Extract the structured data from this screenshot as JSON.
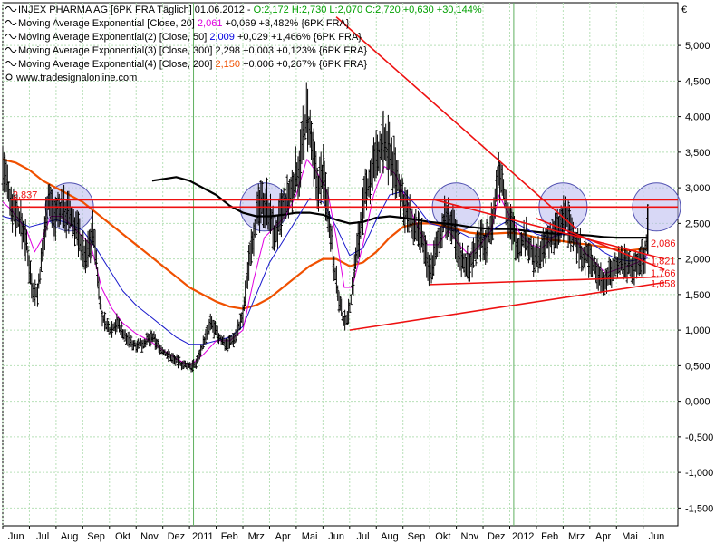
{
  "chart_data": {
    "type": "candlestick",
    "legend": [
      {
        "icon": "wave-icon",
        "parts": [
          {
            "text": "INJEX PHARMA AG [6PK FRA  Täglich] 01.06.2012 - ",
            "color": "#000000"
          },
          {
            "text": "O:2,172 H:2,730 L:2,070 C:2,720 +0,630 +30,144%",
            "color": "#00a000"
          }
        ]
      },
      {
        "icon": "wave-icon",
        "parts": [
          {
            "text": "Moving Average Exponential [Close, 20] ",
            "color": "#000000"
          },
          {
            "text": "2,061",
            "color": "#e000e0"
          },
          {
            "text": " +0,069 +3,482% {6PK FRA}",
            "color": "#000000"
          }
        ]
      },
      {
        "icon": "wave-icon",
        "parts": [
          {
            "text": "Moving Average Exponential(2) [Close, 50] ",
            "color": "#000000"
          },
          {
            "text": "2,009",
            "color": "#0000e0"
          },
          {
            "text": " +0,029 +1,466% {6PK FRA}",
            "color": "#000000"
          }
        ]
      },
      {
        "icon": "wave-icon",
        "parts": [
          {
            "text": "Moving Average Exponential(3) [Close, 300] ",
            "color": "#000000"
          },
          {
            "text": "2,298",
            "color": "#000000"
          },
          {
            "text": " +0,003 +0,123% {6PK FRA}",
            "color": "#000000"
          }
        ]
      },
      {
        "icon": "wave-icon",
        "parts": [
          {
            "text": "Moving Average Exponential(4) [Close, 200] ",
            "color": "#000000"
          },
          {
            "text": "2,150",
            "color": "#f05000"
          },
          {
            "text": " +0,006 +0,267% {6PK FRA}",
            "color": "#000000"
          }
        ]
      }
    ],
    "watermark": "www.tradesignalonline.com",
    "currency": "€",
    "y_ticks": [
      "5,000",
      "4,500",
      "4,000",
      "3,500",
      "3,000",
      "2,500",
      "2,000",
      "1,500",
      "1,000",
      "0,500",
      "0,000",
      "-0,500",
      "-1,000",
      "-1,500"
    ],
    "y_values": [
      5,
      4.5,
      4,
      3.5,
      3,
      2.5,
      2,
      1.5,
      1,
      0.5,
      0,
      -0.5,
      -1,
      -1.5
    ],
    "ylim": [
      -1.75,
      5.6
    ],
    "xlim": [
      0,
      25.3
    ],
    "x_ticks": [
      {
        "label": "Jun",
        "m": 0.5
      },
      {
        "label": "Jul",
        "m": 1.5
      },
      {
        "label": "Aug",
        "m": 2.5
      },
      {
        "label": "Sep",
        "m": 3.5
      },
      {
        "label": "Okt",
        "m": 4.5
      },
      {
        "label": "Nov",
        "m": 5.5
      },
      {
        "label": "Dez",
        "m": 6.5
      },
      {
        "label": "2011",
        "m": 7.5
      },
      {
        "label": "Feb",
        "m": 8.5
      },
      {
        "label": "Mrz",
        "m": 9.5
      },
      {
        "label": "Apr",
        "m": 10.5
      },
      {
        "label": "Mai",
        "m": 11.5
      },
      {
        "label": "Jun",
        "m": 12.5
      },
      {
        "label": "Jul",
        "m": 13.5
      },
      {
        "label": "Aug",
        "m": 14.5
      },
      {
        "label": "Sep",
        "m": 15.5
      },
      {
        "label": "Okt",
        "m": 16.5
      },
      {
        "label": "Nov",
        "m": 17.5
      },
      {
        "label": "Dez",
        "m": 18.5
      },
      {
        "label": "2012",
        "m": 19.5
      },
      {
        "label": "Feb",
        "m": 20.5
      },
      {
        "label": "Mrz",
        "m": 21.5
      },
      {
        "label": "Apr",
        "m": 22.5
      },
      {
        "label": "Mai",
        "m": 23.5
      },
      {
        "label": "Jun",
        "m": 24.5
      }
    ],
    "year_lines": [
      7.15,
      19.15
    ],
    "price_path": [
      [
        0,
        3.3
      ],
      [
        0.3,
        2.8
      ],
      [
        0.6,
        2.6
      ],
      [
        0.9,
        2.2
      ],
      [
        1.1,
        1.6
      ],
      [
        1.3,
        1.5
      ],
      [
        1.5,
        2.1
      ],
      [
        1.7,
        2.9
      ],
      [
        1.9,
        2.6
      ],
      [
        2.2,
        2.7
      ],
      [
        2.5,
        2.6
      ],
      [
        2.8,
        2.4
      ],
      [
        3.1,
        2.0
      ],
      [
        3.4,
        2.4
      ],
      [
        3.7,
        1.2
      ],
      [
        4.0,
        1.0
      ],
      [
        4.3,
        1.1
      ],
      [
        4.6,
        0.9
      ],
      [
        4.9,
        0.8
      ],
      [
        5.2,
        0.8
      ],
      [
        5.6,
        0.9
      ],
      [
        6.0,
        0.7
      ],
      [
        6.4,
        0.6
      ],
      [
        6.8,
        0.5
      ],
      [
        7.2,
        0.5
      ],
      [
        7.5,
        0.8
      ],
      [
        7.8,
        1.1
      ],
      [
        8.1,
        0.9
      ],
      [
        8.4,
        0.8
      ],
      [
        8.7,
        0.9
      ],
      [
        9.0,
        1.2
      ],
      [
        9.3,
        2.2
      ],
      [
        9.6,
        2.7
      ],
      [
        9.9,
        2.8
      ],
      [
        10.2,
        2.3
      ],
      [
        10.5,
        2.7
      ],
      [
        10.8,
        2.9
      ],
      [
        11.1,
        3.3
      ],
      [
        11.4,
        4.0
      ],
      [
        11.6,
        3.5
      ],
      [
        11.8,
        3.0
      ],
      [
        12.0,
        3.2
      ],
      [
        12.2,
        2.7
      ],
      [
        12.4,
        2.0
      ],
      [
        12.6,
        1.4
      ],
      [
        12.8,
        1.1
      ],
      [
        13.0,
        1.3
      ],
      [
        13.3,
        2.2
      ],
      [
        13.6,
        2.9
      ],
      [
        13.9,
        3.3
      ],
      [
        14.2,
        3.6
      ],
      [
        14.5,
        3.5
      ],
      [
        14.8,
        3.1
      ],
      [
        15.1,
        2.7
      ],
      [
        15.4,
        2.4
      ],
      [
        15.7,
        2.3
      ],
      [
        16.0,
        1.8
      ],
      [
        16.3,
        2.2
      ],
      [
        16.6,
        2.6
      ],
      [
        16.9,
        2.4
      ],
      [
        17.2,
        2.0
      ],
      [
        17.5,
        1.9
      ],
      [
        17.8,
        2.3
      ],
      [
        18.1,
        2.2
      ],
      [
        18.4,
        2.6
      ],
      [
        18.6,
        3.3
      ],
      [
        18.8,
        2.9
      ],
      [
        19.0,
        2.5
      ],
      [
        19.3,
        2.2
      ],
      [
        19.6,
        2.3
      ],
      [
        19.9,
        2.0
      ],
      [
        20.2,
        2.1
      ],
      [
        20.5,
        2.3
      ],
      [
        20.8,
        2.4
      ],
      [
        21.1,
        2.6
      ],
      [
        21.4,
        2.3
      ],
      [
        21.7,
        2.1
      ],
      [
        22.0,
        2.0
      ],
      [
        22.3,
        1.8
      ],
      [
        22.6,
        1.7
      ],
      [
        22.9,
        1.9
      ],
      [
        23.2,
        2.0
      ],
      [
        23.5,
        1.9
      ],
      [
        23.8,
        1.9
      ],
      [
        24.0,
        2.1
      ],
      [
        24.1,
        2.0
      ],
      [
        24.17,
        2.72
      ]
    ],
    "ema20": [
      [
        0,
        2.8
      ],
      [
        0.3,
        2.7
      ],
      [
        0.6,
        2.55
      ],
      [
        0.9,
        2.4
      ],
      [
        1.2,
        2.1
      ],
      [
        1.5,
        2.3
      ],
      [
        1.8,
        2.6
      ],
      [
        2.2,
        2.6
      ],
      [
        2.5,
        2.5
      ],
      [
        2.9,
        2.35
      ],
      [
        3.3,
        2.2
      ],
      [
        3.7,
        1.6
      ],
      [
        4.1,
        1.3
      ],
      [
        4.5,
        1.1
      ],
      [
        5.0,
        0.95
      ],
      [
        5.5,
        0.85
      ],
      [
        6.0,
        0.72
      ],
      [
        6.5,
        0.6
      ],
      [
        7.0,
        0.5
      ],
      [
        7.5,
        0.65
      ],
      [
        8.0,
        0.85
      ],
      [
        8.5,
        0.85
      ],
      [
        9.0,
        1.0
      ],
      [
        9.4,
        1.7
      ],
      [
        9.8,
        2.3
      ],
      [
        10.2,
        2.45
      ],
      [
        10.6,
        2.6
      ],
      [
        11.0,
        2.9
      ],
      [
        11.4,
        3.4
      ],
      [
        11.8,
        3.2
      ],
      [
        12.2,
        2.9
      ],
      [
        12.5,
        2.3
      ],
      [
        12.8,
        1.6
      ],
      [
        13.1,
        1.6
      ],
      [
        13.5,
        2.2
      ],
      [
        13.9,
        2.9
      ],
      [
        14.3,
        3.3
      ],
      [
        14.7,
        3.2
      ],
      [
        15.1,
        2.85
      ],
      [
        15.5,
        2.5
      ],
      [
        15.9,
        2.2
      ],
      [
        16.3,
        2.2
      ],
      [
        16.7,
        2.4
      ],
      [
        17.1,
        2.2
      ],
      [
        17.5,
        2.05
      ],
      [
        17.9,
        2.2
      ],
      [
        18.3,
        2.4
      ],
      [
        18.6,
        2.9
      ],
      [
        19.0,
        2.6
      ],
      [
        19.4,
        2.35
      ],
      [
        19.8,
        2.2
      ],
      [
        20.2,
        2.15
      ],
      [
        20.6,
        2.3
      ],
      [
        21.0,
        2.45
      ],
      [
        21.4,
        2.3
      ],
      [
        21.8,
        2.1
      ],
      [
        22.2,
        1.95
      ],
      [
        22.6,
        1.8
      ],
      [
        23.0,
        1.85
      ],
      [
        23.4,
        1.9
      ],
      [
        23.8,
        1.95
      ],
      [
        24.17,
        2.06
      ]
    ],
    "ema50": [
      [
        0,
        2.6
      ],
      [
        0.5,
        2.55
      ],
      [
        1.0,
        2.45
      ],
      [
        1.5,
        2.5
      ],
      [
        2.0,
        2.55
      ],
      [
        2.5,
        2.5
      ],
      [
        3.0,
        2.4
      ],
      [
        3.5,
        2.15
      ],
      [
        4.0,
        1.85
      ],
      [
        4.5,
        1.55
      ],
      [
        5.0,
        1.35
      ],
      [
        5.5,
        1.2
      ],
      [
        6.0,
        1.05
      ],
      [
        6.5,
        0.9
      ],
      [
        7.0,
        0.8
      ],
      [
        7.5,
        0.8
      ],
      [
        8.0,
        0.85
      ],
      [
        8.5,
        0.9
      ],
      [
        9.0,
        1.05
      ],
      [
        9.5,
        1.5
      ],
      [
        10.0,
        1.95
      ],
      [
        10.5,
        2.25
      ],
      [
        11.0,
        2.55
      ],
      [
        11.5,
        2.85
      ],
      [
        12.0,
        2.8
      ],
      [
        12.5,
        2.45
      ],
      [
        13.0,
        2.05
      ],
      [
        13.5,
        2.15
      ],
      [
        14.0,
        2.55
      ],
      [
        14.5,
        2.9
      ],
      [
        15.0,
        2.95
      ],
      [
        15.5,
        2.75
      ],
      [
        16.0,
        2.5
      ],
      [
        16.5,
        2.45
      ],
      [
        17.0,
        2.4
      ],
      [
        17.5,
        2.3
      ],
      [
        18.0,
        2.3
      ],
      [
        18.5,
        2.45
      ],
      [
        19.0,
        2.55
      ],
      [
        19.5,
        2.45
      ],
      [
        20.0,
        2.35
      ],
      [
        20.5,
        2.3
      ],
      [
        21.0,
        2.35
      ],
      [
        21.5,
        2.35
      ],
      [
        22.0,
        2.25
      ],
      [
        22.5,
        2.1
      ],
      [
        23.0,
        2.0
      ],
      [
        23.5,
        1.97
      ],
      [
        24.17,
        2.01
      ]
    ],
    "ema300": [
      [
        5.6,
        3.1
      ],
      [
        6.5,
        3.15
      ],
      [
        7.0,
        3.1
      ],
      [
        7.5,
        3.0
      ],
      [
        8.0,
        2.9
      ],
      [
        8.5,
        2.75
      ],
      [
        9.0,
        2.65
      ],
      [
        9.5,
        2.6
      ],
      [
        10.0,
        2.6
      ],
      [
        10.5,
        2.62
      ],
      [
        11.0,
        2.65
      ],
      [
        11.5,
        2.65
      ],
      [
        12.0,
        2.62
      ],
      [
        12.5,
        2.55
      ],
      [
        13.0,
        2.5
      ],
      [
        13.5,
        2.52
      ],
      [
        14.0,
        2.58
      ],
      [
        14.5,
        2.6
      ],
      [
        15.0,
        2.58
      ],
      [
        15.5,
        2.55
      ],
      [
        16.0,
        2.52
      ],
      [
        16.5,
        2.5
      ],
      [
        17.0,
        2.48
      ],
      [
        17.5,
        2.45
      ],
      [
        18.0,
        2.43
      ],
      [
        18.5,
        2.42
      ],
      [
        19.0,
        2.42
      ],
      [
        19.5,
        2.4
      ],
      [
        20.0,
        2.38
      ],
      [
        20.5,
        2.36
      ],
      [
        21.0,
        2.35
      ],
      [
        21.5,
        2.34
      ],
      [
        22.0,
        2.33
      ],
      [
        22.5,
        2.31
      ],
      [
        23.0,
        2.3
      ],
      [
        23.5,
        2.3
      ],
      [
        24.17,
        2.3
      ]
    ],
    "ema200": [
      [
        0,
        3.4
      ],
      [
        0.5,
        3.35
      ],
      [
        1.0,
        3.25
      ],
      [
        1.5,
        3.1
      ],
      [
        2.0,
        3.0
      ],
      [
        2.5,
        2.9
      ],
      [
        3.0,
        2.8
      ],
      [
        3.5,
        2.65
      ],
      [
        4.0,
        2.5
      ],
      [
        4.5,
        2.35
      ],
      [
        5.0,
        2.2
      ],
      [
        5.5,
        2.05
      ],
      [
        6.0,
        1.9
      ],
      [
        6.5,
        1.75
      ],
      [
        7.0,
        1.6
      ],
      [
        7.5,
        1.5
      ],
      [
        8.0,
        1.4
      ],
      [
        8.5,
        1.33
      ],
      [
        9.0,
        1.3
      ],
      [
        9.5,
        1.35
      ],
      [
        10.0,
        1.45
      ],
      [
        10.5,
        1.6
      ],
      [
        11.0,
        1.75
      ],
      [
        11.5,
        1.9
      ],
      [
        12.0,
        2.0
      ],
      [
        12.5,
        2.0
      ],
      [
        13.0,
        1.9
      ],
      [
        13.5,
        1.95
      ],
      [
        14.0,
        2.1
      ],
      [
        14.5,
        2.3
      ],
      [
        15.0,
        2.45
      ],
      [
        15.5,
        2.5
      ],
      [
        16.0,
        2.5
      ],
      [
        16.5,
        2.47
      ],
      [
        17.0,
        2.42
      ],
      [
        17.5,
        2.37
      ],
      [
        18.0,
        2.35
      ],
      [
        18.5,
        2.36
      ],
      [
        19.0,
        2.37
      ],
      [
        19.5,
        2.35
      ],
      [
        20.0,
        2.3
      ],
      [
        20.5,
        2.27
      ],
      [
        21.0,
        2.25
      ],
      [
        21.5,
        2.22
      ],
      [
        22.0,
        2.2
      ],
      [
        22.5,
        2.17
      ],
      [
        23.0,
        2.13
      ],
      [
        23.5,
        2.12
      ],
      [
        24.17,
        2.15
      ]
    ],
    "trendlines": [
      {
        "x1": 12.5,
        "y1": 5.4,
        "x2": 21.5,
        "y2": 2.42
      },
      {
        "x1": 13.0,
        "y1": 1.0,
        "x2": 24.8,
        "y2": 1.67
      },
      {
        "x1": 16.2,
        "y1": 2.83,
        "x2": 24.8,
        "y2": 2.0
      },
      {
        "x1": 16.0,
        "y1": 1.64,
        "x2": 24.8,
        "y2": 1.75
      },
      {
        "x1": 20.0,
        "y1": 2.57,
        "x2": 24.8,
        "y2": 1.85
      }
    ],
    "resistance_levels": [
      2.83,
      2.73
    ],
    "resistance_x_start": 0.3,
    "circles": [
      {
        "cx": 2.5,
        "cy": 2.73
      },
      {
        "cx": 9.8,
        "cy": 2.73
      },
      {
        "cx": 17.0,
        "cy": 2.73
      },
      {
        "cx": 21.0,
        "cy": 2.73
      },
      {
        "cx": 24.5,
        "cy": 2.73
      }
    ],
    "circle_radius": 0.9,
    "level_labels": [
      {
        "text": "2,837",
        "value": 2.83,
        "side": "left",
        "x": 0.3
      },
      {
        "text": "2,086",
        "value": 2.15,
        "side": "right"
      },
      {
        "text": "1,821",
        "value": 1.9,
        "side": "right"
      },
      {
        "text": "1,766",
        "value": 1.73,
        "side": "right"
      },
      {
        "text": "1,658",
        "value": 1.58,
        "side": "right"
      }
    ],
    "colors": {
      "ema20": "#e000e0",
      "ema50": "#1a1acc",
      "ema200": "#f05000",
      "ema300": "#000000",
      "price": "#000000",
      "trend": "#ee1111",
      "circle_fill": "#b8b8ee",
      "circle_stroke": "#5050b0",
      "grid": "#b8e0b8"
    }
  }
}
